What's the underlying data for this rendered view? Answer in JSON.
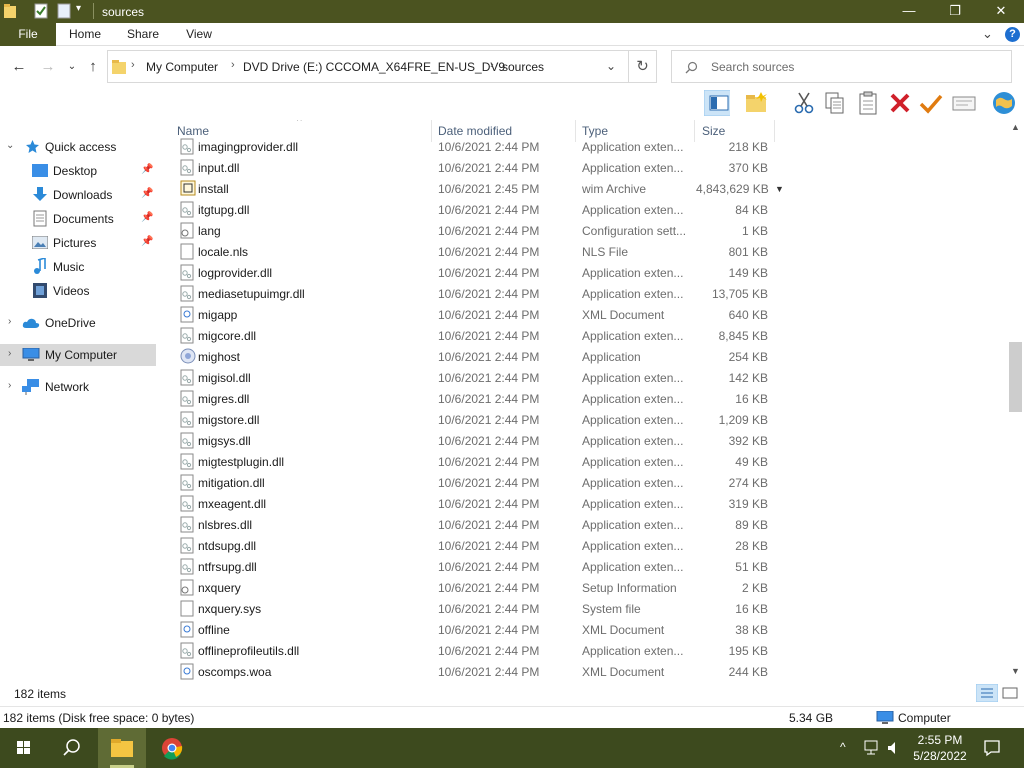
{
  "window": {
    "title": "sources",
    "controls": {
      "minimize": "—",
      "maximize": "❐",
      "close": "✕"
    }
  },
  "ribbon": {
    "tabs": [
      "File",
      "Home",
      "Share",
      "View"
    ],
    "collapse_glyph": "⌄",
    "help_glyph": "?"
  },
  "address": {
    "crumbs": [
      "My Computer",
      "DVD Drive (E:) CCCOMA_X64FRE_EN-US_DV9",
      "sources"
    ],
    "search_placeholder": "Search sources"
  },
  "nav": {
    "quick_access": "Quick access",
    "items": [
      {
        "label": "Desktop",
        "icon": "desktop-icon",
        "pinned": true
      },
      {
        "label": "Downloads",
        "icon": "downloads-icon",
        "pinned": true
      },
      {
        "label": "Documents",
        "icon": "documents-icon",
        "pinned": true
      },
      {
        "label": "Pictures",
        "icon": "pictures-icon",
        "pinned": true
      },
      {
        "label": "Music",
        "icon": "music-icon",
        "pinned": false
      },
      {
        "label": "Videos",
        "icon": "videos-icon",
        "pinned": false
      }
    ],
    "onedrive": "OneDrive",
    "my_computer": "My Computer",
    "network": "Network"
  },
  "columns": {
    "name": "Name",
    "date": "Date modified",
    "type": "Type",
    "size": "Size"
  },
  "files": [
    {
      "name": "imagingprovider.dll",
      "date": "10/6/2021 2:44 PM",
      "type": "Application exten...",
      "size": "218 KB",
      "icon": "dll"
    },
    {
      "name": "input.dll",
      "date": "10/6/2021 2:44 PM",
      "type": "Application exten...",
      "size": "370 KB",
      "icon": "dll"
    },
    {
      "name": "install",
      "date": "10/6/2021 2:45 PM",
      "type": "wim Archive",
      "size": "4,843,629 KB",
      "icon": "wim"
    },
    {
      "name": "itgtupg.dll",
      "date": "10/6/2021 2:44 PM",
      "type": "Application exten...",
      "size": "84 KB",
      "icon": "dll"
    },
    {
      "name": "lang",
      "date": "10/6/2021 2:44 PM",
      "type": "Configuration sett...",
      "size": "1 KB",
      "icon": "cfg"
    },
    {
      "name": "locale.nls",
      "date": "10/6/2021 2:44 PM",
      "type": "NLS File",
      "size": "801 KB",
      "icon": "blank"
    },
    {
      "name": "logprovider.dll",
      "date": "10/6/2021 2:44 PM",
      "type": "Application exten...",
      "size": "149 KB",
      "icon": "dll"
    },
    {
      "name": "mediasetupuimgr.dll",
      "date": "10/6/2021 2:44 PM",
      "type": "Application exten...",
      "size": "13,705 KB",
      "icon": "dll"
    },
    {
      "name": "migapp",
      "date": "10/6/2021 2:44 PM",
      "type": "XML Document",
      "size": "640 KB",
      "icon": "xml"
    },
    {
      "name": "migcore.dll",
      "date": "10/6/2021 2:44 PM",
      "type": "Application exten...",
      "size": "8,845 KB",
      "icon": "dll"
    },
    {
      "name": "mighost",
      "date": "10/6/2021 2:44 PM",
      "type": "Application",
      "size": "254 KB",
      "icon": "exe"
    },
    {
      "name": "migisol.dll",
      "date": "10/6/2021 2:44 PM",
      "type": "Application exten...",
      "size": "142 KB",
      "icon": "dll"
    },
    {
      "name": "migres.dll",
      "date": "10/6/2021 2:44 PM",
      "type": "Application exten...",
      "size": "16 KB",
      "icon": "dll"
    },
    {
      "name": "migstore.dll",
      "date": "10/6/2021 2:44 PM",
      "type": "Application exten...",
      "size": "1,209 KB",
      "icon": "dll"
    },
    {
      "name": "migsys.dll",
      "date": "10/6/2021 2:44 PM",
      "type": "Application exten...",
      "size": "392 KB",
      "icon": "dll"
    },
    {
      "name": "migtestplugin.dll",
      "date": "10/6/2021 2:44 PM",
      "type": "Application exten...",
      "size": "49 KB",
      "icon": "dll"
    },
    {
      "name": "mitigation.dll",
      "date": "10/6/2021 2:44 PM",
      "type": "Application exten...",
      "size": "274 KB",
      "icon": "dll"
    },
    {
      "name": "mxeagent.dll",
      "date": "10/6/2021 2:44 PM",
      "type": "Application exten...",
      "size": "319 KB",
      "icon": "dll"
    },
    {
      "name": "nlsbres.dll",
      "date": "10/6/2021 2:44 PM",
      "type": "Application exten...",
      "size": "89 KB",
      "icon": "dll"
    },
    {
      "name": "ntdsupg.dll",
      "date": "10/6/2021 2:44 PM",
      "type": "Application exten...",
      "size": "28 KB",
      "icon": "dll"
    },
    {
      "name": "ntfrsupg.dll",
      "date": "10/6/2021 2:44 PM",
      "type": "Application exten...",
      "size": "51 KB",
      "icon": "dll"
    },
    {
      "name": "nxquery",
      "date": "10/6/2021 2:44 PM",
      "type": "Setup Information",
      "size": "2 KB",
      "icon": "cfg"
    },
    {
      "name": "nxquery.sys",
      "date": "10/6/2021 2:44 PM",
      "type": "System file",
      "size": "16 KB",
      "icon": "blank"
    },
    {
      "name": "offline",
      "date": "10/6/2021 2:44 PM",
      "type": "XML Document",
      "size": "38 KB",
      "icon": "xml"
    },
    {
      "name": "offlineprofileutils.dll",
      "date": "10/6/2021 2:44 PM",
      "type": "Application exten...",
      "size": "195 KB",
      "icon": "dll"
    },
    {
      "name": "oscomps.woa",
      "date": "10/6/2021 2:44 PM",
      "type": "XML Document",
      "size": "244 KB",
      "icon": "xml"
    }
  ],
  "status": {
    "item_count": "182 items",
    "detail": "182 items (Disk free space: 0 bytes)",
    "size": "5.34 GB",
    "location": "Computer"
  },
  "taskbar": {
    "time": "2:55 PM",
    "date": "5/28/2022"
  },
  "colors": {
    "titlebar": "#4b5320",
    "taskbar": "#3d4a1e",
    "selection": "#d9d9d9",
    "column_header_text": "#4c607a"
  }
}
